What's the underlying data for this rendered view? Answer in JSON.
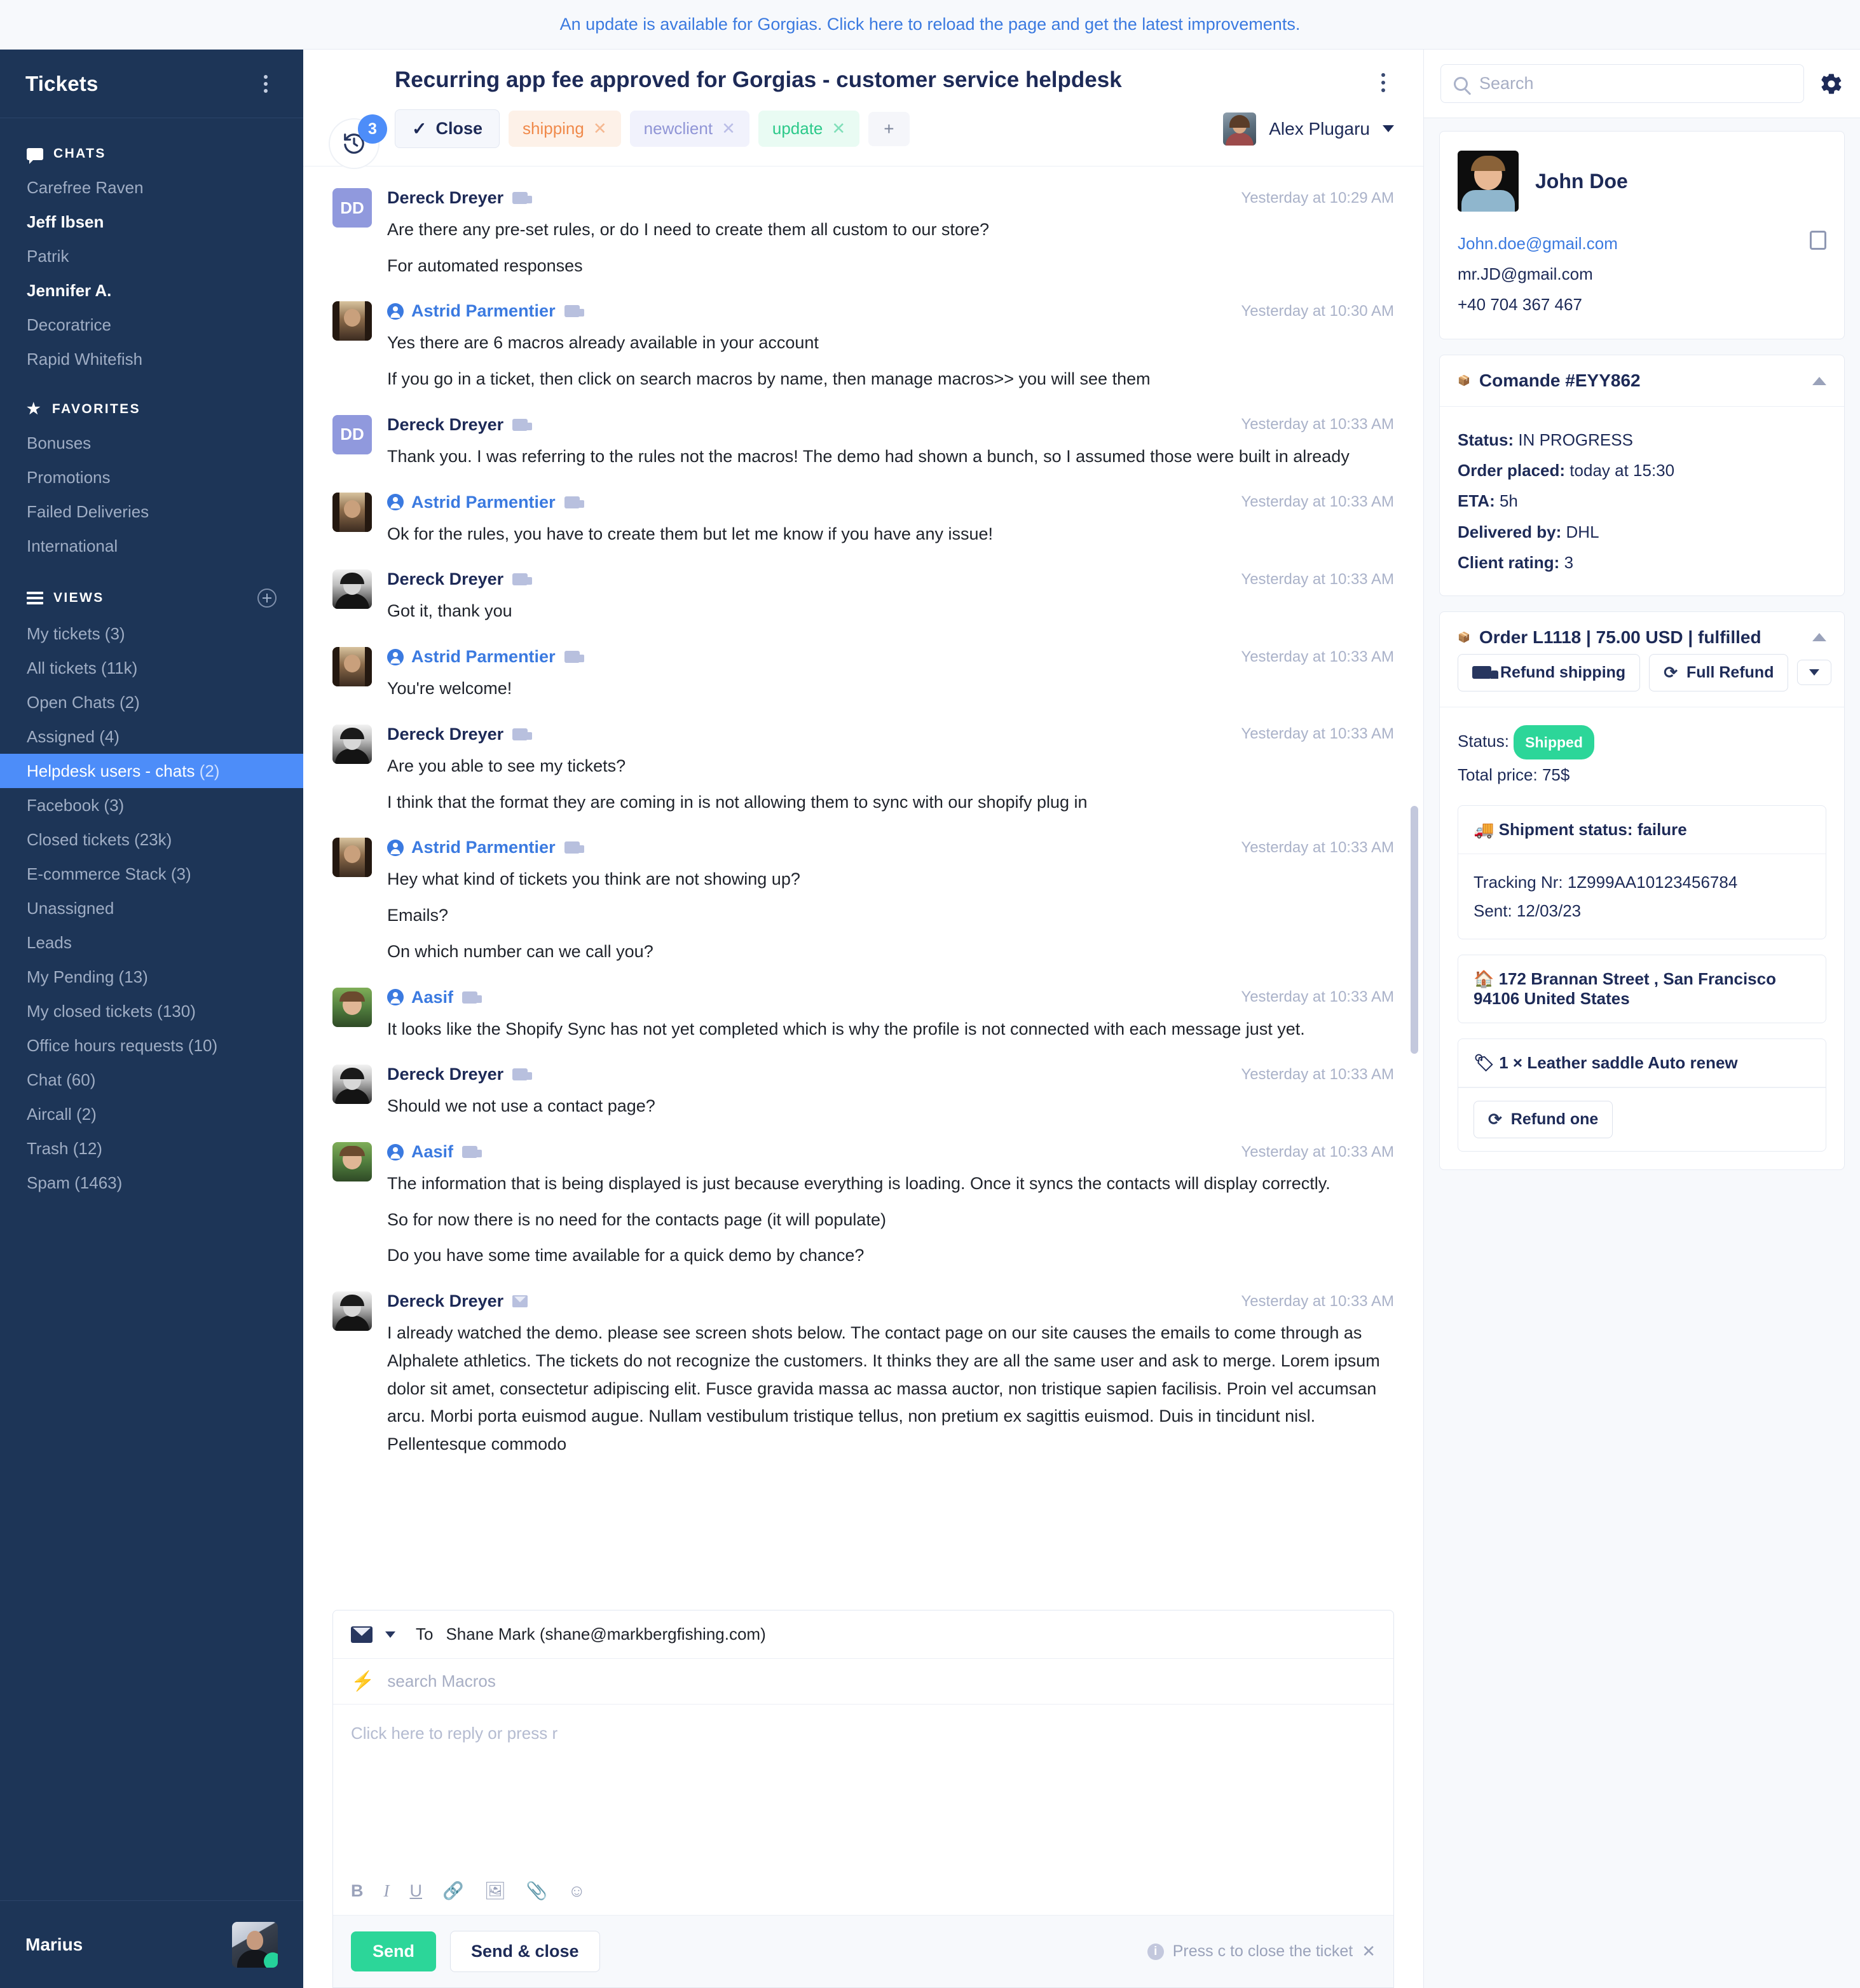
{
  "banner": {
    "text": "An update is available for Gorgias. Click here to reload the page and get the latest improvements."
  },
  "sidebar": {
    "title": "Tickets",
    "groups": [
      {
        "label": "CHATS",
        "icon": "chat-icon",
        "items": [
          {
            "label": "Carefree Raven",
            "bold": false
          },
          {
            "label": "Jeff Ibsen",
            "bold": true
          },
          {
            "label": "Patrik",
            "bold": false
          },
          {
            "label": "Jennifer A.",
            "bold": true
          },
          {
            "label": "Decoratrice",
            "bold": false
          },
          {
            "label": "Rapid Whitefish",
            "bold": false
          }
        ]
      },
      {
        "label": "FAVORITES",
        "icon": "star-icon",
        "items": [
          {
            "label": "Bonuses"
          },
          {
            "label": "Promotions"
          },
          {
            "label": "Failed Deliveries"
          },
          {
            "label": "International"
          }
        ]
      },
      {
        "label": "VIEWS",
        "icon": "views-icon",
        "add": true,
        "items": [
          {
            "label": "My tickets",
            "count": "(3)"
          },
          {
            "label": "All tickets",
            "count": "(11k)"
          },
          {
            "label": "Open Chats",
            "count": "(2)"
          },
          {
            "label": "Assigned",
            "count": "(4)"
          },
          {
            "label": "Helpdesk users - chats",
            "count": "(2)",
            "active": true
          },
          {
            "label": "Facebook",
            "count": "(3)"
          },
          {
            "label": "Closed tickets",
            "count": "(23k)"
          },
          {
            "label": "E-commerce Stack",
            "count": "(3)"
          },
          {
            "label": "Unassigned",
            "count": ""
          },
          {
            "label": "Leads",
            "count": ""
          },
          {
            "label": "My Pending",
            "count": "(13)"
          },
          {
            "label": "My closed tickets",
            "count": "(130)"
          },
          {
            "label": "Office hours requests",
            "count": "(10)"
          },
          {
            "label": "Chat",
            "count": "(60)"
          },
          {
            "label": "Aircall",
            "count": "(2)"
          },
          {
            "label": "Trash",
            "count": "(12)"
          },
          {
            "label": "Spam",
            "count": "(1463)"
          }
        ]
      }
    ],
    "current_user": "Marius"
  },
  "ticket": {
    "history_badge": "3",
    "title": "Recurring app fee approved for Gorgias - customer service helpdesk",
    "close_label": "Close",
    "tags": [
      {
        "label": "shipping",
        "color": "#f08a4b"
      },
      {
        "label": "newclient",
        "color": "#9095d6"
      },
      {
        "label": "update",
        "color": "#2cc98a"
      }
    ],
    "add_tag_label": "+",
    "assignee": "Alex Plugaru"
  },
  "messages": [
    {
      "sender": "Dereck Dreyer",
      "agent": false,
      "avatar": "initials",
      "initials": "DD",
      "channel": "chat-icon",
      "time": "Yesterday at 10:29 AM",
      "lines": [
        "Are there any pre-set rules, or do I need to create them all custom to our store?",
        "For automated responses"
      ]
    },
    {
      "sender": "Astrid Parmentier",
      "agent": true,
      "avatar": "photo-f",
      "channel": "chat-icon",
      "time": "Yesterday at 10:30 AM",
      "lines": [
        "Yes there are 6 macros already available in your account",
        "If you go in a ticket, then click on search macros by name, then manage macros>> you will see them"
      ]
    },
    {
      "sender": "Dereck Dreyer",
      "agent": false,
      "avatar": "initials",
      "initials": "DD",
      "channel": "chat-icon",
      "time": "Yesterday at 10:33 AM",
      "lines": [
        "Thank you. I was referring to the rules not the macros! The demo had shown a bunch, so I assumed those were built in already"
      ]
    },
    {
      "sender": "Astrid Parmentier",
      "agent": true,
      "avatar": "photo-f",
      "channel": "chat-icon",
      "time": "Yesterday at 10:33 AM",
      "lines": [
        "Ok for the rules, you have to create them but let me know if you have any issue!"
      ]
    },
    {
      "sender": "Dereck Dreyer",
      "agent": false,
      "avatar": "photo-m",
      "channel": "chat-icon",
      "time": "Yesterday at 10:33 AM",
      "lines": [
        "Got it, thank you"
      ]
    },
    {
      "sender": "Astrid Parmentier",
      "agent": true,
      "avatar": "photo-f",
      "channel": "chat-icon",
      "time": "Yesterday at 10:33 AM",
      "lines": [
        "You're welcome!"
      ]
    },
    {
      "sender": "Dereck Dreyer",
      "agent": false,
      "avatar": "photo-m",
      "channel": "chat-icon",
      "time": "Yesterday at 10:33 AM",
      "lines": [
        "Are you able to see my tickets?",
        "I think that the format they are coming in is not allowing them to sync with our shopify plug in"
      ]
    },
    {
      "sender": "Astrid Parmentier",
      "agent": true,
      "avatar": "photo-f",
      "channel": "chat-icon",
      "time": "Yesterday at 10:33 AM",
      "lines": [
        "Hey what kind of tickets you think are not showing up?",
        "Emails?",
        "On which number can we call you?"
      ]
    },
    {
      "sender": "Aasif",
      "agent": true,
      "avatar": "photo-a",
      "channel": "chat-icon",
      "time": "Yesterday at 10:33 AM",
      "lines": [
        "It looks like the Shopify Sync has not yet completed which is why the profile is not connected with each message just yet."
      ]
    },
    {
      "sender": "Dereck Dreyer",
      "agent": false,
      "avatar": "photo-m",
      "channel": "chat-icon",
      "time": "Yesterday at 10:33 AM",
      "lines": [
        "Should we not use a contact page?"
      ]
    },
    {
      "sender": "Aasif",
      "agent": true,
      "avatar": "photo-a",
      "channel": "chat-icon",
      "time": "Yesterday at 10:33 AM",
      "lines": [
        "The information that is being displayed is just because everything is loading. Once it syncs the contacts will display correctly.",
        "So for now there is no need for the contacts page (it will populate)",
        "Do you have some time available for a quick demo by chance?"
      ]
    },
    {
      "sender": "Dereck Dreyer",
      "agent": false,
      "avatar": "photo-m",
      "channel": "email-icon",
      "time": "Yesterday at 10:33 AM",
      "lines": [
        "I already watched the demo. please see screen shots below. The contact page on our site causes the emails to come through as Alphalete athletics. The tickets do not recognize the customers. It thinks they are all the same user and ask to merge.  Lorem ipsum dolor sit amet, consectetur adipiscing elit. Fusce gravida massa ac massa auctor, non tristique sapien facilisis. Proin vel accumsan arcu. Morbi porta euismod augue. Nullam vestibulum tristique tellus, non pretium ex sagittis euismod. Duis in tincidunt nisl. Pellentesque commodo"
      ]
    }
  ],
  "composer": {
    "to_label": "To",
    "to_value": "Shane Mark (shane@markbergfishing.com)",
    "macro_placeholder": "search Macros",
    "reply_placeholder": "Click here to reply or press r",
    "tools": [
      "B",
      "I",
      "U",
      "link-icon",
      "image-icon",
      "attachment-icon",
      "emoji-icon"
    ],
    "send_label": "Send",
    "send_close_label": "Send & close",
    "hint": "Press c to close the ticket"
  },
  "right": {
    "search_placeholder": "Search",
    "customer": {
      "name": "John Doe",
      "emails": [
        "John.doe@gmail.com",
        "mr.JD@gmail.com"
      ],
      "phone": "+40 704 367 467"
    },
    "comande": {
      "title": "Comande #EYY862",
      "icon": "package-icon",
      "rows": [
        {
          "k": "Status:",
          "v": "IN PROGRESS"
        },
        {
          "k": "Order placed:",
          "v": "today at 15:30"
        },
        {
          "k": "ETA:",
          "v": "5h"
        },
        {
          "k": "Delivered by:",
          "v": "DHL"
        },
        {
          "k": "Client rating:",
          "v": "3"
        }
      ]
    },
    "order": {
      "title": "Order L1118 | 75.00 USD | fulfilled",
      "icon": "package-icon",
      "refund_shipping_label": "Refund shipping",
      "full_refund_label": "Full Refund",
      "status_label": "Status:",
      "status_badge": "Shipped",
      "total_price": "Total price: 75$",
      "shipment_title": "🚚 Shipment status: failure",
      "tracking": "Tracking Nr: 1Z999AA10123456784",
      "sent": "Sent: 12/03/23",
      "address": "🏠 172 Brannan Street , San Francisco 94106 United States",
      "line_item": "🏷 1 × Leather saddle Auto renew",
      "refund_one_label": "Refund one"
    }
  },
  "colors": {
    "sidebar_bg": "#1d3557",
    "accent_blue": "#4d8df9",
    "link_blue": "#3b7ae0",
    "green": "#2cd699",
    "navy_text": "#1d2a57"
  }
}
